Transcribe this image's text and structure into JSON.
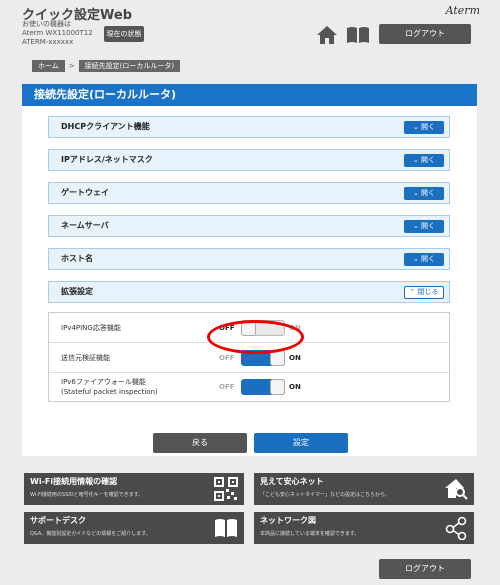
{
  "header": {
    "title": "クイック設定Web",
    "device_line1": "お使いの機器は",
    "device_line2": "Aterm WX11000T12",
    "device_line3": "ATERM-xxxxxx",
    "status_button": "現在の状態",
    "brand": "Aterm",
    "logout": "ログアウト"
  },
  "breadcrumb": [
    "ホーム",
    "接続先設定(ローカルルータ)"
  ],
  "panel": {
    "title": "接続先設定(ローカルルータ)",
    "sections": [
      {
        "label": "DHCPクライアント機能",
        "button": "開く"
      },
      {
        "label": "IPアドレス/ネットマスク",
        "button": "開く"
      },
      {
        "label": "ゲートウェイ",
        "button": "開く"
      },
      {
        "label": "ネームサーバ",
        "button": "開く"
      },
      {
        "label": "ホスト名",
        "button": "開く"
      },
      {
        "label": "拡張設定",
        "button": "閉じる"
      }
    ],
    "advanced": [
      {
        "label": "IPv4PING応答機能",
        "label2": "",
        "off": "OFF",
        "on": "ON",
        "state": "off"
      },
      {
        "label": "送信元検証機能",
        "label2": "",
        "off": "OFF",
        "on": "ON",
        "state": "on"
      },
      {
        "label": "IPv6ファイアウォール機能",
        "label2": "(Stateful packet inspection)",
        "off": "OFF",
        "on": "ON",
        "state": "on"
      }
    ],
    "back": "戻る",
    "set": "設定"
  },
  "tiles": [
    {
      "title": "Wi-Fi接続用情報の確認",
      "desc": "Wi-Fi接続用のSSIDと暗号化キーを確認できます。",
      "icon": "qr-code-icon"
    },
    {
      "title": "見えて安心ネット",
      "desc": "「こども安心ネットタイマー」などの設定はこちらから。",
      "icon": "home-search-icon"
    },
    {
      "title": "サポートデスク",
      "desc": "Q&A、機能別設定ガイドなどの情報をご紹介します。",
      "icon": "book-icon"
    },
    {
      "title": "ネットワーク図",
      "desc": "本商品に接続している端末を確認できます。",
      "icon": "share-icon"
    }
  ],
  "footer": {
    "logout": "ログアウト"
  },
  "colors": {
    "accent": "#1a73c6",
    "dark_button": "#555555",
    "highlight": "#e00000"
  }
}
